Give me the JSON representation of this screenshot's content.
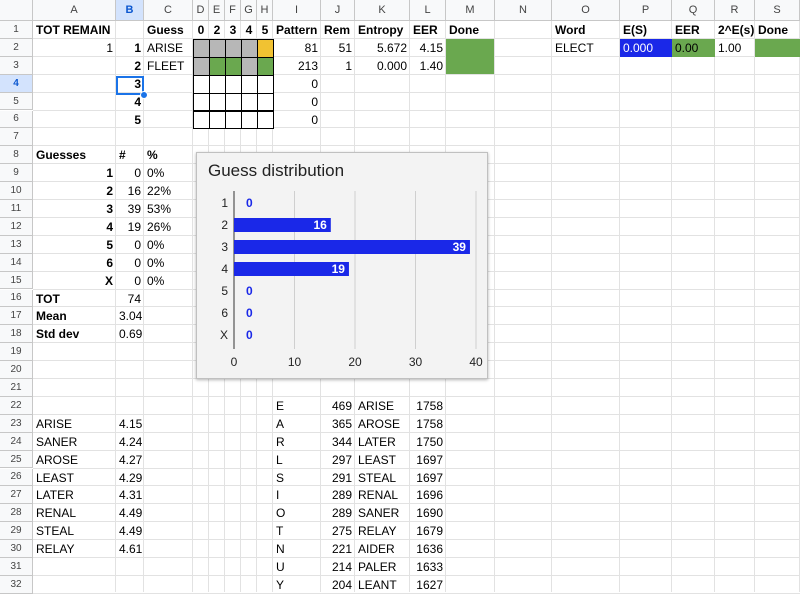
{
  "columns": [
    "A",
    "B",
    "C",
    "D",
    "E",
    "F",
    "G",
    "H",
    "I",
    "J",
    "K",
    "L",
    "M",
    "N",
    "O",
    "P",
    "Q",
    "R",
    "S"
  ],
  "selected_column": "B",
  "selected_row": 4,
  "rows": [
    1,
    2,
    3,
    4,
    5,
    6,
    7,
    8,
    9,
    10,
    11,
    12,
    13,
    14,
    15,
    16,
    17,
    18,
    19,
    20,
    21,
    22,
    23,
    24,
    25,
    26,
    27,
    28,
    29,
    30,
    31,
    32
  ],
  "header_row": {
    "tot_remain": "TOT REMAIN",
    "guess": "Guess",
    "pos": [
      "0",
      "2",
      "3",
      "4",
      "5"
    ],
    "pattern": "Pattern",
    "rem": "Rem",
    "entropy": "Entropy",
    "eer": "EER",
    "done": "Done",
    "word": "Word",
    "es": "E(S)",
    "eer2": "EER",
    "two_es": "2^E(s)",
    "done2": "Done"
  },
  "tot_remain_value": "1",
  "guess_rows": [
    {
      "n": "1",
      "word": "ARISE",
      "pattern": "81",
      "rem": "51",
      "entropy": "5.672",
      "eer": "4.15"
    },
    {
      "n": "2",
      "word": "FLEET",
      "pattern": "213",
      "rem": "1",
      "entropy": "0.000",
      "eer": "1.40"
    },
    {
      "n": "3",
      "word": "",
      "pattern": "0",
      "rem": "",
      "entropy": "",
      "eer": ""
    },
    {
      "n": "4",
      "word": "",
      "pattern": "0",
      "rem": "",
      "entropy": "",
      "eer": ""
    },
    {
      "n": "5",
      "word": "",
      "pattern": "0",
      "rem": "",
      "entropy": "",
      "eer": ""
    }
  ],
  "grid_colors": {
    "gray": "#b7b7b7",
    "green": "#6aa84f",
    "yellow": "#f1c232",
    "white": "#ffffff",
    "done_green": "#6aa84f",
    "blue": "#1a28e8"
  },
  "grid": [
    [
      "gray",
      "gray",
      "gray",
      "gray",
      "yellow"
    ],
    [
      "gray",
      "green",
      "green",
      "gray",
      "green"
    ],
    [
      "white",
      "white",
      "white",
      "white",
      "white"
    ],
    [
      "white",
      "white",
      "white",
      "white",
      "white"
    ],
    [
      "white",
      "white",
      "white",
      "white",
      "white"
    ]
  ],
  "right_panel": {
    "word": "ELECT",
    "es": "0.000",
    "eer": "0.00",
    "two_es": "1.00"
  },
  "stats_header": {
    "guesses": "Guesses",
    "num": "#",
    "pct": "%"
  },
  "stats": [
    {
      "label": "1",
      "n": "0",
      "pct": "0%"
    },
    {
      "label": "2",
      "n": "16",
      "pct": "22%"
    },
    {
      "label": "3",
      "n": "39",
      "pct": "53%"
    },
    {
      "label": "4",
      "n": "19",
      "pct": "26%"
    },
    {
      "label": "5",
      "n": "0",
      "pct": "0%"
    },
    {
      "label": "6",
      "n": "0",
      "pct": "0%"
    },
    {
      "label": "X",
      "n": "0",
      "pct": "0%"
    }
  ],
  "totals": [
    {
      "label": "TOT",
      "value": "74"
    },
    {
      "label": "Mean",
      "value": "3.04"
    },
    {
      "label": "Std dev",
      "value": "0.69"
    }
  ],
  "word_eer_list": [
    {
      "word": "ARISE",
      "eer": "4.15"
    },
    {
      "word": "SANER",
      "eer": "4.24"
    },
    {
      "word": "AROSE",
      "eer": "4.27"
    },
    {
      "word": "LEAST",
      "eer": "4.29"
    },
    {
      "word": "LATER",
      "eer": "4.31"
    },
    {
      "word": "RENAL",
      "eer": "4.49"
    },
    {
      "word": "STEAL",
      "eer": "4.49"
    },
    {
      "word": "RELAY",
      "eer": "4.61"
    }
  ],
  "letter_freq": [
    {
      "letter": "E",
      "count": "469",
      "word": "ARISE",
      "score": "1758"
    },
    {
      "letter": "A",
      "count": "365",
      "word": "AROSE",
      "score": "1758"
    },
    {
      "letter": "R",
      "count": "344",
      "word": "LATER",
      "score": "1750"
    },
    {
      "letter": "L",
      "count": "297",
      "word": "LEAST",
      "score": "1697"
    },
    {
      "letter": "S",
      "count": "291",
      "word": "STEAL",
      "score": "1697"
    },
    {
      "letter": "I",
      "count": "289",
      "word": "RENAL",
      "score": "1696"
    },
    {
      "letter": "O",
      "count": "289",
      "word": "SANER",
      "score": "1690"
    },
    {
      "letter": "T",
      "count": "275",
      "word": "RELAY",
      "score": "1679"
    },
    {
      "letter": "N",
      "count": "221",
      "word": "AIDER",
      "score": "1636"
    },
    {
      "letter": "U",
      "count": "214",
      "word": "PALER",
      "score": "1633"
    },
    {
      "letter": "Y",
      "count": "204",
      "word": "LEANT",
      "score": "1627"
    }
  ],
  "chart_data": {
    "type": "bar",
    "orientation": "horizontal",
    "title": "Guess distribution",
    "categories": [
      "1",
      "2",
      "3",
      "4",
      "5",
      "6",
      "X"
    ],
    "values": [
      0,
      16,
      39,
      19,
      0,
      0,
      0
    ],
    "xlim": [
      0,
      40
    ],
    "xticks": [
      "0",
      "10",
      "20",
      "30",
      "40"
    ],
    "grid": true,
    "bar_color": "#1a28e8",
    "data_labels": true
  }
}
